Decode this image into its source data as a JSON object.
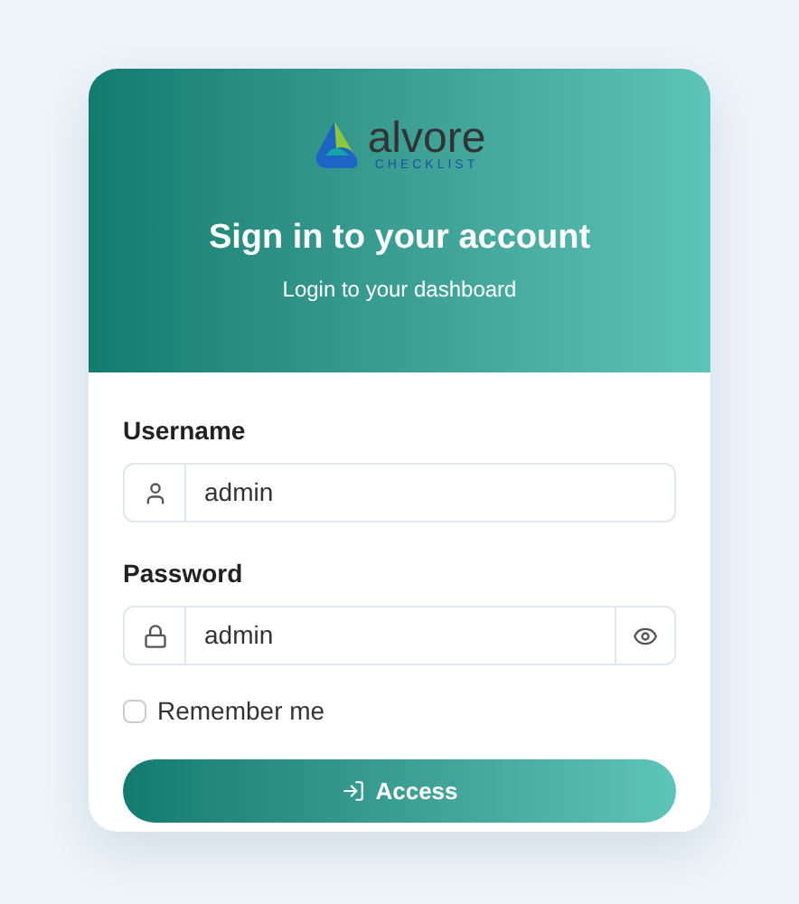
{
  "logo": {
    "name": "alvore",
    "tagline": "CHECKLIST"
  },
  "header": {
    "title": "Sign in to your account",
    "subtitle": "Login to your dashboard"
  },
  "fields": [
    {
      "label": "Username",
      "value": "admin",
      "kind": "user"
    },
    {
      "label": "Password",
      "value": "admin",
      "kind": "password"
    }
  ],
  "remember": {
    "label": "Remember me",
    "checked": false
  },
  "button": {
    "label": "Access"
  }
}
